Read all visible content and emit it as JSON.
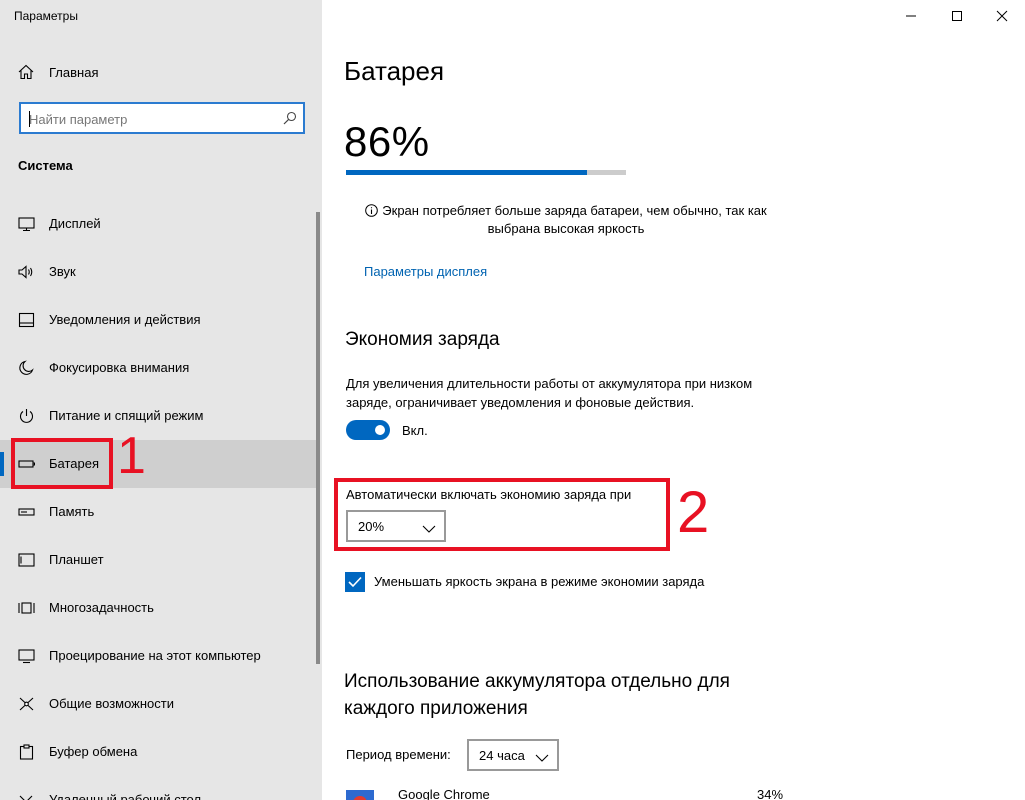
{
  "window": {
    "title": "Параметры",
    "controls": [
      "minimize-icon",
      "maximize-icon",
      "close-icon"
    ]
  },
  "sidebar": {
    "home_label": "Главная",
    "search_placeholder": "Найти параметр",
    "section_title": "Система",
    "items": [
      {
        "label": "Дисплей",
        "icon": "display-icon"
      },
      {
        "label": "Звук",
        "icon": "speaker-icon"
      },
      {
        "label": "Уведомления и действия",
        "icon": "notifications-icon"
      },
      {
        "label": "Фокусировка внимания",
        "icon": "moon-icon"
      },
      {
        "label": "Питание и спящий режим",
        "icon": "power-icon"
      },
      {
        "label": "Батарея",
        "icon": "battery-icon",
        "active": true
      },
      {
        "label": "Память",
        "icon": "storage-icon"
      },
      {
        "label": "Планшет",
        "icon": "tablet-icon"
      },
      {
        "label": "Многозадачность",
        "icon": "multitasking-icon"
      },
      {
        "label": "Проецирование на этот компьютер",
        "icon": "projecting-icon"
      },
      {
        "label": "Общие возможности",
        "icon": "shared-experiences-icon"
      },
      {
        "label": "Буфер обмена",
        "icon": "clipboard-icon"
      },
      {
        "label": "Удаленный рабочий стол",
        "icon": "remote-desktop-icon"
      }
    ]
  },
  "annotations": {
    "label1": "1",
    "label2": "2",
    "color": "#e81123"
  },
  "main": {
    "title": "Батарея",
    "battery_percent_text": "86%",
    "battery_level": 0.86,
    "note": "Экран потребляет больше заряда батареи, чем обычно, так как выбрана высокая яркость",
    "display_link": "Параметры дисплея",
    "saver": {
      "heading": "Экономия заряда",
      "description": "Для увеличения длительности работы от аккумулятора при низком заряде, ограничивает уведомления и фоновые действия.",
      "toggle_label": "Вкл.",
      "toggle_on": true,
      "auto_label": "Автоматически включать экономию заряда при",
      "auto_value": "20%",
      "checkbox_label": "Уменьшать яркость экрана в режиме экономии заряда",
      "checkbox_checked": true
    },
    "usage": {
      "heading": "Использование аккумулятора отдельно для каждого приложения",
      "period_label": "Период времени:",
      "period_value": "24 часа",
      "apps": [
        {
          "name": "Google Chrome",
          "percent": "34%"
        }
      ]
    }
  },
  "colors": {
    "accent": "#0067c0",
    "sidebar_bg": "#e6e6e6",
    "link": "#0063b1"
  }
}
